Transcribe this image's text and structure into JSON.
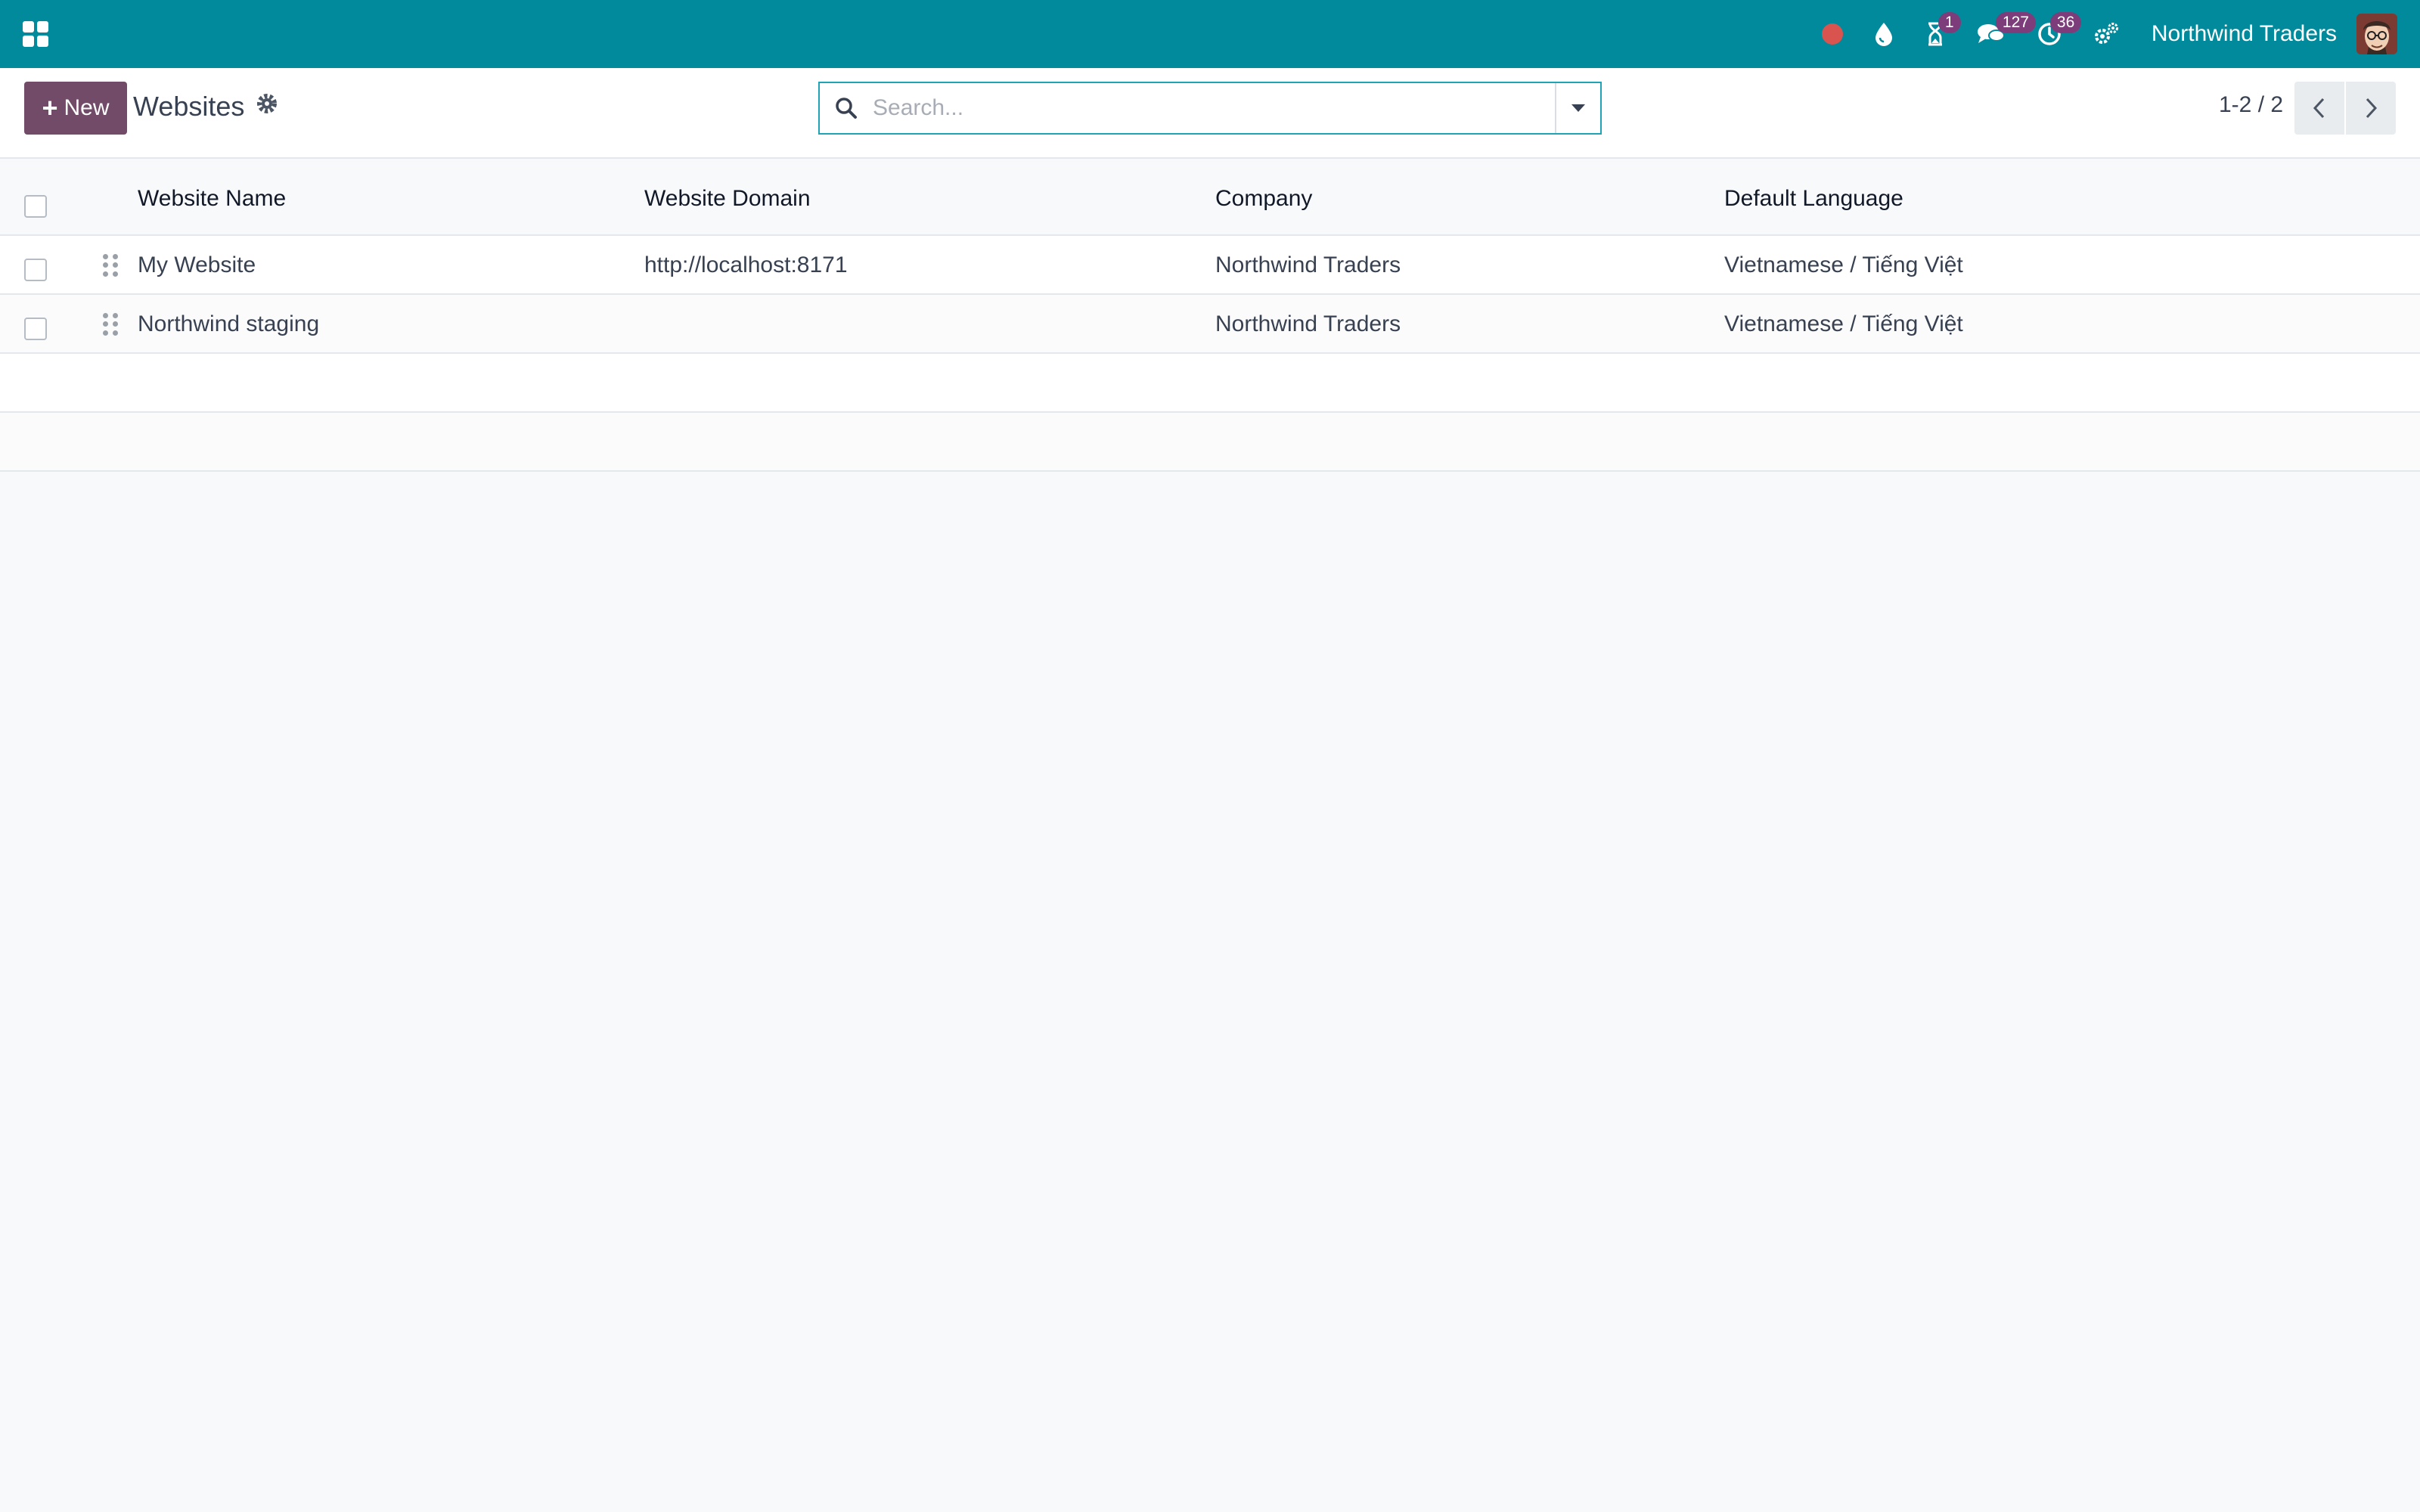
{
  "navbar": {
    "company_name": "Northwind Traders",
    "activity_badge": "1",
    "messages_badge": "127",
    "clock_badge": "36",
    "color": "#018a9b"
  },
  "control_panel": {
    "new_label": "New",
    "title": "Websites",
    "search_placeholder": "Search...",
    "pager_value": "1-2 / 2",
    "accent_color": "#714b67"
  },
  "list": {
    "columns": [
      "Website Name",
      "Website Domain",
      "Company",
      "Default Language"
    ],
    "rows": [
      {
        "name": "My Website",
        "domain": "http://localhost:8171",
        "company": "Northwind Traders",
        "language": "Vietnamese / Tiếng Việt"
      },
      {
        "name": "Northwind staging",
        "domain": "",
        "company": "Northwind Traders",
        "language": "Vietnamese / Tiếng Việt"
      }
    ]
  }
}
